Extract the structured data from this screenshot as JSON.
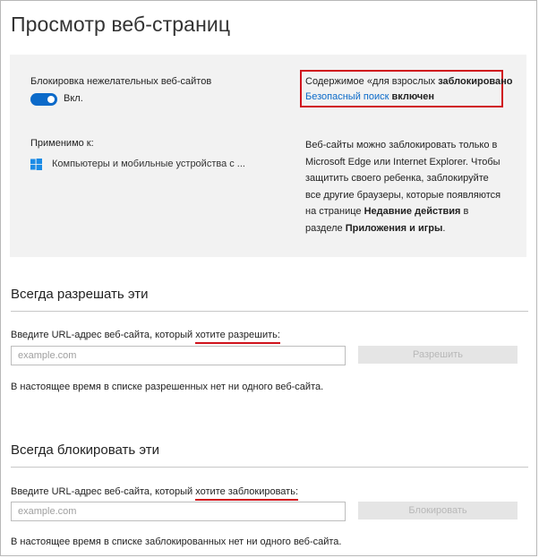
{
  "page_title": "Просмотр веб-страниц",
  "blocking": {
    "title": "Блокировка нежелательных веб-сайтов",
    "toggle_state": "Вкл.",
    "toggle_on": true,
    "applies_label": "Применимо к:",
    "applies_devices": "Компьютеры и мобильные устройства с ..."
  },
  "status_box": {
    "line1_prefix": "Содержимое «для взрослых ",
    "line1_bold": "заблокировано",
    "line2_link": "Безопасный поиск",
    "line2_bold": " включен"
  },
  "info": {
    "text_before": "Веб-сайты можно заблокировать только в Microsoft Edge или Internet Explorer. Чтобы защитить своего ребенка, заблокируйте все другие браузеры, которые появляются на странице ",
    "bold1": "Недавние действия",
    "text_middle": " в разделе ",
    "bold2": "Приложения и игры",
    "text_after": "."
  },
  "allow": {
    "heading": "Всегда разрешать эти",
    "label_prefix": "Введите URL-адрес веб-сайта, который ",
    "label_emph": "хотите разрешить:",
    "placeholder": "example.com",
    "button": "Разрешить",
    "status": "В настоящее время в списке разрешенных нет ни одного веб-сайта."
  },
  "block": {
    "heading": "Всегда блокировать эти",
    "label_prefix": "Введите URL-адрес веб-сайта, который ",
    "label_emph": "хотите заблокировать:",
    "placeholder": "example.com",
    "button": "Блокировать",
    "status": "В настоящее время в списке заблокированных нет ни одного веб-сайта."
  },
  "colors": {
    "accent": "#0b6ac9",
    "highlight_red": "#d0141d",
    "panel_bg": "#f2f2f2"
  },
  "icons": {
    "windows": "windows-logo-icon"
  }
}
